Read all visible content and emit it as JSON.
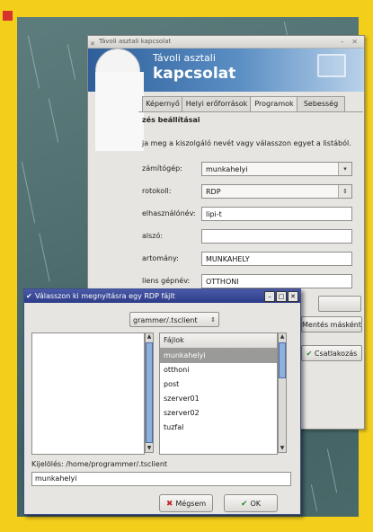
{
  "colors": {
    "page_bg": "#f3cf1c",
    "corner_mark": "#d6332e",
    "title_blue": "#2c3c88",
    "selection": "#9a9a98"
  },
  "main_window": {
    "title": "Távoli asztali kapcsolat",
    "banner_line1": "Távoli asztali",
    "banner_line2": "kapcsolat",
    "tabs": [
      "Képernyő",
      "Helyi erőforrások",
      "Programok",
      "Sebesség"
    ],
    "section_title": "zés beállításai",
    "hint": "ja meg a kiszolgáló nevét vagy válasszon egyet a listából.",
    "fields": [
      {
        "label": "zámítógép:",
        "value": "munkahelyi",
        "kind": "combo-edit"
      },
      {
        "label": "rotokoll:",
        "value": "RDP",
        "kind": "combo"
      },
      {
        "label": "elhasználónév:",
        "value": "lipi-t",
        "kind": "text"
      },
      {
        "label": "alszó:",
        "value": "",
        "kind": "text"
      },
      {
        "label": "artomány:",
        "value": "MUNKAHELY",
        "kind": "text"
      },
      {
        "label": "liens gépnév:",
        "value": "OTTHONI",
        "kind": "text"
      }
    ],
    "save_as_button": "Mentés másként",
    "connect_button": "Csatlakozás"
  },
  "dialog": {
    "title": "Válasszon ki megnyitásra egy RDP fájlt",
    "controls": [
      "–",
      "□",
      "✕"
    ],
    "path": "grammer/.tsclient",
    "file_header": "Fájlok",
    "files": [
      "munkahelyi",
      "otthoni",
      "post",
      "szerver01",
      "szerver02",
      "tuzfal"
    ],
    "selected_index": 0,
    "selection_label": "Kijelölés: /home/programmer/.tsclient",
    "selection_value": "munkahelyi",
    "cancel_button": "Mégsem",
    "ok_button": "OK"
  }
}
